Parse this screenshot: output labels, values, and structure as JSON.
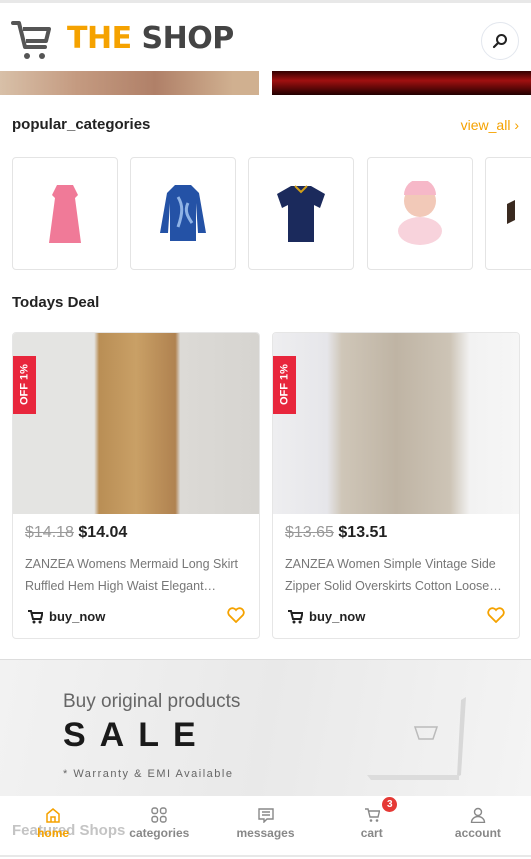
{
  "header": {
    "logo_part1": "THE",
    "logo_part2": "SHOP",
    "colors": {
      "accent": "#f5a200",
      "dark": "#444444"
    }
  },
  "popular": {
    "title": "popular_categories",
    "view_all": "view_all"
  },
  "categories": [
    {
      "icon": "pink-dress"
    },
    {
      "icon": "blue-hoodie"
    },
    {
      "icon": "football-jersey"
    },
    {
      "icon": "baby-doll"
    },
    {
      "icon": "partial-item"
    }
  ],
  "deals": {
    "title": "Todays Deal",
    "items": [
      {
        "badge": "OFF 1%",
        "old_price": "$14.18",
        "price": "$14.04",
        "name": "ZANZEA Womens Mermaid Long Skirt Ruffled Hem High Waist Elegant…",
        "buy": "buy_now"
      },
      {
        "badge": "OFF 1%",
        "old_price": "$13.65",
        "price": "$13.51",
        "name": "ZANZEA Women Simple Vintage Side Zipper Solid Overskirts Cotton Loose…",
        "buy": "buy_now"
      }
    ]
  },
  "promo": {
    "line1": "Buy original products",
    "line2": "SALE",
    "line3": "* Warranty & EMI Available"
  },
  "featured": {
    "title": "Featured Shops"
  },
  "nav": {
    "items": [
      {
        "label": "home"
      },
      {
        "label": "categories"
      },
      {
        "label": "messages"
      },
      {
        "label": "cart",
        "badge": "3"
      },
      {
        "label": "account"
      }
    ]
  }
}
